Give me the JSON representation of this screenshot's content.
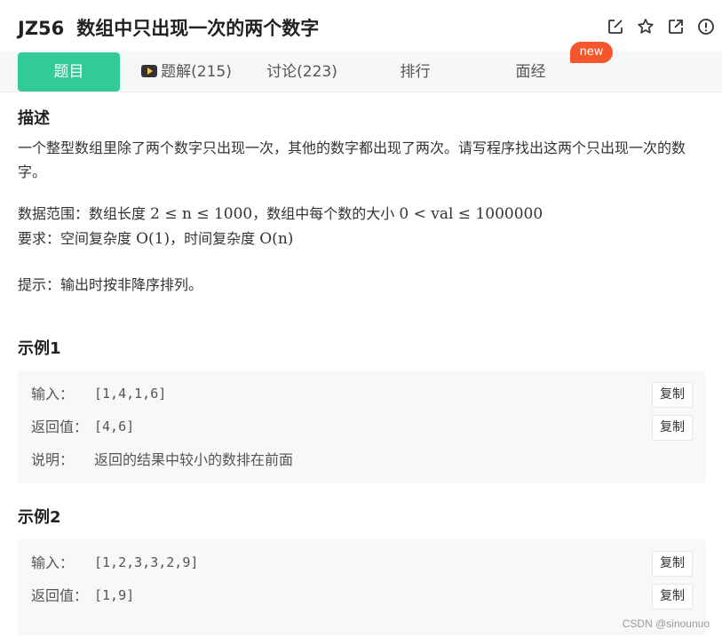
{
  "header": {
    "code": "JZ56",
    "title": "数组中只出现一次的两个数字",
    "icons": [
      "edit-icon",
      "star-icon",
      "external-link-icon",
      "report-icon"
    ]
  },
  "tabs": [
    {
      "label": "题目",
      "active": true
    },
    {
      "label": "题解(215)",
      "icon": "video-icon"
    },
    {
      "label": "讨论(223)"
    },
    {
      "label": "排行"
    },
    {
      "label": "面经",
      "badge": "new"
    }
  ],
  "description": {
    "heading": "描述",
    "text": "一个整型数组里除了两个数字只出现一次，其他的数字都出现了两次。请写程序找出这两个只出现一次的数字。",
    "range_prefix": "数据范围：数组长度",
    "range_math1": "2 ≤ n ≤ 1000",
    "range_mid": "，数组中每个数的大小",
    "range_math2": "0 < val ≤ 1000000",
    "req_prefix": "要求：空间复杂度",
    "req_math1": "O(1)",
    "req_mid": "，时间复杂度",
    "req_math2": "O(n)",
    "hint": "提示：输出时按非降序排列。"
  },
  "examples": [
    {
      "heading": "示例1",
      "input_label": "输入：",
      "input": "[1,4,1,6]",
      "output_label": "返回值：",
      "output": "[4,6]",
      "explain_label": "说明：",
      "explain": "返回的结果中较小的数排在前面",
      "copy": "复制"
    },
    {
      "heading": "示例2",
      "input_label": "输入：",
      "input": "[1,2,3,3,2,9]",
      "output_label": "返回值：",
      "output": "[1,9]",
      "copy": "复制"
    }
  ],
  "watermark": "CSDN @sinounuo",
  "colors": {
    "accent": "#32ca99",
    "badge": "#f5562b",
    "tab_bar": "#f6f7f9",
    "example_bg": "#f7f8fa"
  }
}
